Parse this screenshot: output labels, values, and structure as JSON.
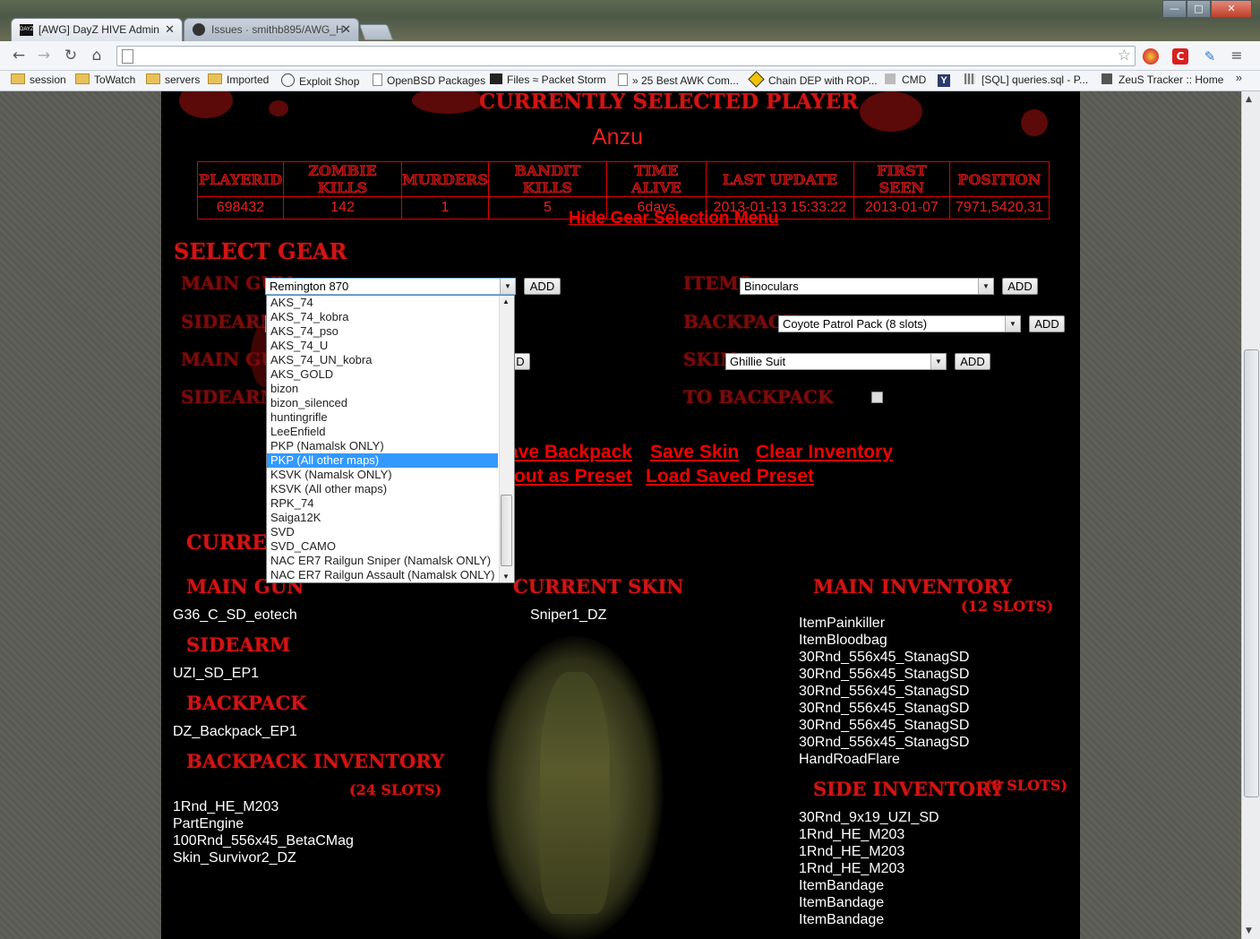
{
  "browser": {
    "tabs": [
      {
        "title": "[AWG] DayZ HIVE Admin",
        "active": true
      },
      {
        "title": "Issues · smithb895/AWG_H",
        "active": false
      }
    ],
    "window_controls": {
      "minimize": "—",
      "maximize": "□",
      "close": "✕"
    },
    "address": "",
    "bookmarks": [
      {
        "label": "session",
        "icon": "folder-icon"
      },
      {
        "label": "ToWatch",
        "icon": "folder-icon"
      },
      {
        "label": "servers",
        "icon": "folder-icon"
      },
      {
        "label": "Imported",
        "icon": "folder-icon"
      },
      {
        "label": "Exploit Shop",
        "icon": "wordpress-icon"
      },
      {
        "label": "OpenBSD Packages",
        "icon": "page-icon"
      },
      {
        "label": "Files ≈ Packet Storm",
        "icon": "packetstorm-icon"
      },
      {
        "label": "» 25 Best AWK Com...",
        "icon": "page-icon"
      },
      {
        "label": "Chain DEP with ROP...",
        "icon": "warning-sign-icon"
      },
      {
        "label": "CMD",
        "icon": "page-icon"
      },
      {
        "label": "",
        "icon": "y-icon"
      },
      {
        "label": "[SQL] queries.sql - P...",
        "icon": "grid-icon"
      },
      {
        "label": "ZeuS Tracker :: Home",
        "icon": "zeus-icon"
      }
    ]
  },
  "page": {
    "heading": "CURRENTLY SELECTED PLAYER",
    "player_name": "Anzu",
    "stats_headers": [
      "PLAYERID",
      "ZOMBIE KILLS",
      "MURDERS",
      "BANDIT KILLS",
      "TIME ALIVE",
      "LAST UPDATE",
      "FIRST SEEN",
      "POSITION"
    ],
    "stats_values": [
      "698432",
      "142",
      "1",
      "5",
      "6days",
      "2013-01-13 15:33:22",
      "2013-01-07",
      "7971,5420,31"
    ],
    "hide_gear_link": "Hide Gear Selection Menu",
    "select_gear_heading": "SELECT GEAR",
    "gear_labels": {
      "main_gun": "MAIN GUN",
      "sidearm": "SIDEARM",
      "main_gun_ammo": "MAIN GUN",
      "sidearm_ammo": "SIDEARM A",
      "items": "ITEMS",
      "backpack": "BACKPACK",
      "skin": "SKIN",
      "to_backpack": "TO BACKPACK"
    },
    "selects": {
      "main_gun": "Remington 870",
      "sidearm_partial": "G",
      "items": "Binoculars",
      "backpack": "Coyote Patrol Pack (8 slots)",
      "skin": "Ghillie Suit"
    },
    "add_label": "ADD",
    "dropdown_options": [
      "AKS_74",
      "AKS_74_kobra",
      "AKS_74_pso",
      "AKS_74_U",
      "AKS_74_UN_kobra",
      "AKS_GOLD",
      "bizon",
      "bizon_silenced",
      "huntingrifle",
      "LeeEnfield",
      "PKP (Namalsk ONLY)",
      "PKP (All other maps)",
      "KSVK (Namalsk ONLY)",
      "KSVK (All other maps)",
      "RPK_74",
      "Saiga12K",
      "SVD",
      "SVD_CAMO",
      "NAC ER7 Railgun Sniper (Namalsk ONLY)",
      "NAC ER7 Railgun Assault (Namalsk ONLY)"
    ],
    "dropdown_highlighted": "PKP (All other maps)",
    "action_links": {
      "save_backpack": "ave Backpack",
      "save_skin": "Save Skin",
      "clear_inventory": "Clear Inventory",
      "save_preset": "out as Preset",
      "load_preset": "Load Saved Preset"
    },
    "current_heading": "CURRENT",
    "current": {
      "main_gun_label": "MAIN GUN",
      "main_gun": "G36_C_SD_eotech",
      "sidearm_label": "SIDEARM",
      "sidearm": "UZI_SD_EP1",
      "backpack_label": "BACKPACK",
      "backpack": "DZ_Backpack_EP1",
      "backpack_inv_label": "BACKPACK INVENTORY",
      "backpack_slots": "(24 SLOTS)",
      "backpack_items": [
        "1Rnd_HE_M203",
        "PartEngine",
        "100Rnd_556x45_BetaCMag",
        "Skin_Survivor2_DZ"
      ],
      "skin_label": "CURRENT SKIN",
      "skin": "Sniper1_DZ",
      "main_inv_label": "MAIN INVENTORY",
      "main_slots": "(12 SLOTS)",
      "main_items": [
        "ItemPainkiller",
        "ItemBloodbag",
        "30Rnd_556x45_StanagSD",
        "30Rnd_556x45_StanagSD",
        "30Rnd_556x45_StanagSD",
        "30Rnd_556x45_StanagSD",
        "30Rnd_556x45_StanagSD",
        "30Rnd_556x45_StanagSD",
        "HandRoadFlare"
      ],
      "side_inv_label": "SIDE INVENTORY",
      "side_slots": "(8 SLOTS)",
      "side_items": [
        "30Rnd_9x19_UZI_SD",
        "1Rnd_HE_M203",
        "1Rnd_HE_M203",
        "1Rnd_HE_M203",
        "ItemBandage",
        "ItemBandage",
        "ItemBandage"
      ]
    }
  },
  "colors": {
    "accent": "#d11414",
    "background": "#000000",
    "highlight": "#3399ff"
  }
}
